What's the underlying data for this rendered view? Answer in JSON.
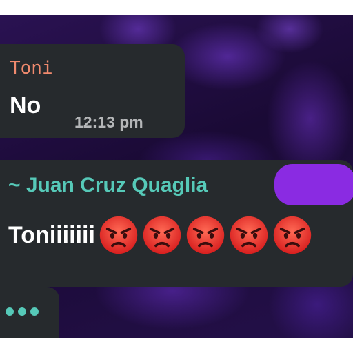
{
  "messages": [
    {
      "sender": "Toni",
      "text": "No",
      "time": "12:13 pm"
    },
    {
      "sender": "~ Juan Cruz Quaglia",
      "text": "Toniiiiiii",
      "emoji": "angry-face-icon",
      "emoji_count": 5
    }
  ],
  "typing_indicator": "typing-dots-icon",
  "colors": {
    "bubble": "#262a2d",
    "sender_toni": "#f08a6e",
    "sender_juan": "#56c9b8",
    "time": "#b4b6b8",
    "redaction": "#8a2be2",
    "wallpaper": "#1a0a35"
  }
}
